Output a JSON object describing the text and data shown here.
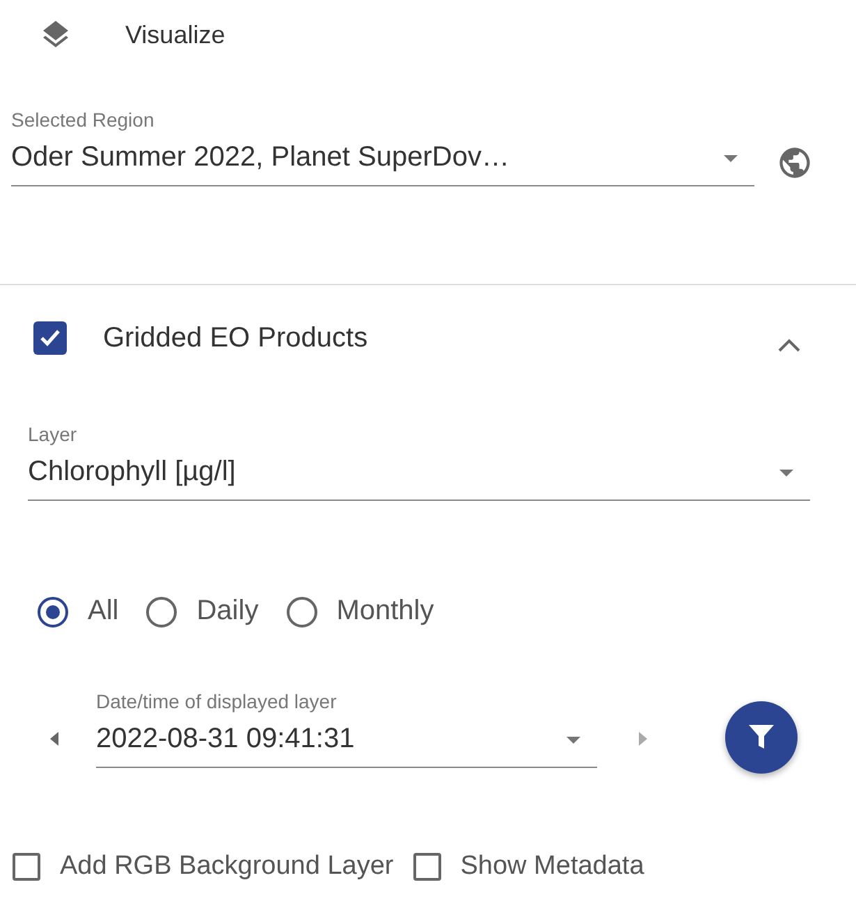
{
  "header": {
    "title": "Visualize"
  },
  "region": {
    "label": "Selected Region",
    "value": "Oder Summer 2022, Planet SuperDov…"
  },
  "section": {
    "title": "Gridded EO Products",
    "checked": true,
    "expanded": true,
    "layer": {
      "label": "Layer",
      "value": "Chlorophyll [µg/l]"
    },
    "modes": [
      {
        "label": "All",
        "selected": true
      },
      {
        "label": "Daily",
        "selected": false
      },
      {
        "label": "Monthly",
        "selected": false
      }
    ],
    "datetime": {
      "label": "Date/time of displayed layer",
      "value": "2022-08-31 09:41:31"
    }
  },
  "options": [
    {
      "label": "Add RGB Background Layer",
      "checked": false
    },
    {
      "label": "Show Metadata",
      "checked": false
    }
  ]
}
